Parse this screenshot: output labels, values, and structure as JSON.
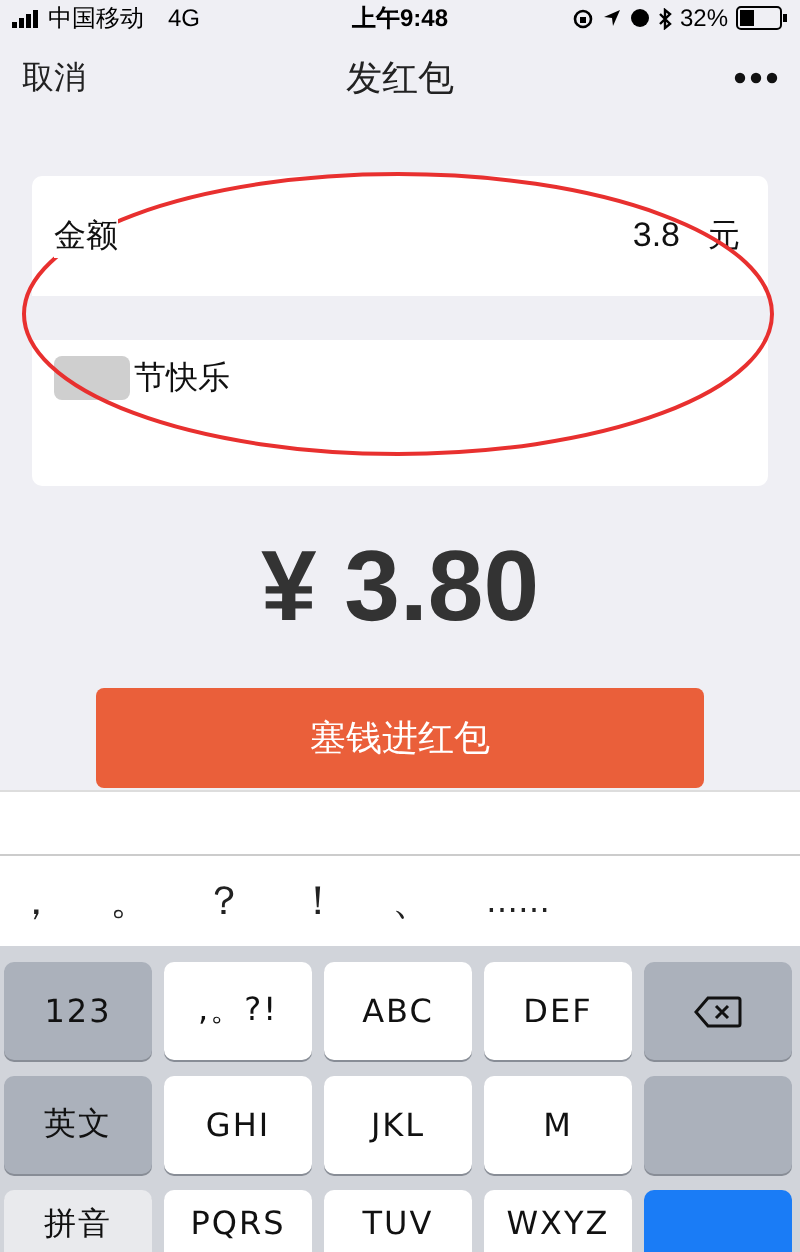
{
  "status_bar": {
    "carrier": "中国移动",
    "network": "4G",
    "time": "上午9:48",
    "battery": "32%"
  },
  "nav": {
    "cancel": "取消",
    "title": "发红包"
  },
  "form": {
    "amount_label": "金额",
    "amount_value": "3.8",
    "amount_unit": "元",
    "greeting": "节快乐",
    "greeting_blurred": true
  },
  "total": "¥ 3.80",
  "submit_button": "塞钱进红包",
  "annotation": {
    "kind": "ellipse"
  },
  "candidates": [
    "，",
    "。",
    "？",
    "！",
    "、",
    "……"
  ],
  "keys": [
    [
      {
        "kind": "function",
        "label": "123"
      },
      {
        "kind": "letter",
        "label": ",。?!"
      },
      {
        "kind": "letter",
        "label": "ABC"
      },
      {
        "kind": "letter",
        "label": "DEF"
      },
      {
        "kind": "delete"
      }
    ],
    [
      {
        "kind": "function",
        "label": "英文"
      },
      {
        "kind": "letter",
        "label": "GHI"
      },
      {
        "kind": "letter",
        "label": "JKL"
      },
      {
        "kind": "letter",
        "label": "M"
      },
      {
        "kind": "function"
      }
    ],
    [
      {
        "kind": "mode",
        "label": "拼音"
      },
      {
        "kind": "letter",
        "label": "PQRS"
      },
      {
        "kind": "letter",
        "label": "TUV"
      },
      {
        "kind": "letter",
        "label": "WXYZ"
      },
      {
        "kind": "confirm"
      }
    ]
  ]
}
